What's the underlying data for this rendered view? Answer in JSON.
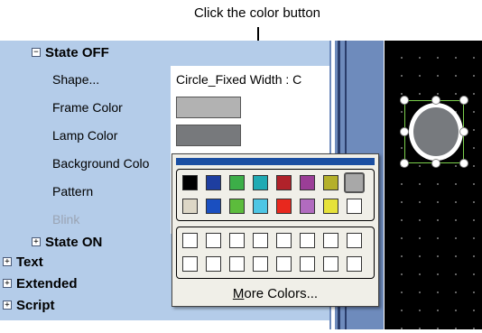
{
  "callout": "Click the color button",
  "sections": {
    "state_off": "State OFF",
    "state_on": "State ON",
    "text": "Text",
    "extended": "Extended",
    "script": "Script"
  },
  "properties": [
    {
      "name": "Shape...",
      "value": "Circle_Fixed Width : C"
    },
    {
      "name": "Frame Color",
      "swatch": "#b2b2b2"
    },
    {
      "name": "Lamp Color",
      "swatch": "#77797c"
    },
    {
      "name": "Background Colo"
    },
    {
      "name": "Pattern"
    },
    {
      "name": "Blink"
    }
  ],
  "palette": {
    "row1": [
      "#000000",
      "#1e3ea0",
      "#3cae48",
      "#20aab3",
      "#b0222a",
      "#9b3e97",
      "#b4b02a",
      "#a8a8a8"
    ],
    "row2": [
      "#ddd7c6",
      "#1a4fc0",
      "#5cbc3c",
      "#4ec6e4",
      "#e8281e",
      "#b16bbf",
      "#e6e23a",
      "#ffffff"
    ],
    "more_colors_label": "More Colors...",
    "more_colors_mnemonic": "M"
  },
  "colors": {
    "panel": "#b4cce9",
    "selection": "#1b4fa2",
    "canvas": "#000000"
  }
}
